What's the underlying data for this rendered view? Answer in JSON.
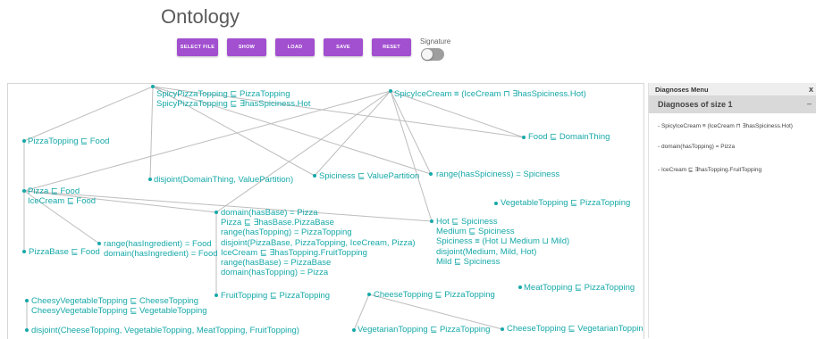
{
  "header": {
    "title": "Ontology",
    "buttons": [
      "SELECT FILE",
      "SHOW",
      "LOAD",
      "SAVE",
      "RESET"
    ],
    "signature_label": "Signature",
    "signature_on": false,
    "accent_color": "#a24fd0"
  },
  "graph": {
    "node_color": "#17a8a8",
    "edge_color": "#bdbdbd",
    "nodes": [
      {
        "id": "spicy-pizza-topping",
        "lines": [
          "SpicyPizzaTopping ⊑ PizzaTopping",
          "SpicyPizzaTopping ⊑ ∃hasSpiciness.Hot"
        ]
      },
      {
        "id": "spicy-ice-cream",
        "lines": [
          "SpicyIceCream ≡ (IceCream ⊓ ∃hasSpiciness.Hot)"
        ]
      },
      {
        "id": "pizza-topping-food",
        "lines": [
          "PizzaTopping ⊑ Food"
        ]
      },
      {
        "id": "food-domain-thing",
        "lines": [
          "Food ⊑ DomainThing"
        ]
      },
      {
        "id": "disjoint-domain-value",
        "lines": [
          "disjoint(DomainThing, ValuePartition)"
        ]
      },
      {
        "id": "spiciness-value-partition",
        "lines": [
          "Spiciness ⊑ ValuePartition"
        ]
      },
      {
        "id": "range-has-spiciness",
        "lines": [
          "range(hasSpiciness) = Spiciness"
        ]
      },
      {
        "id": "pizza-food",
        "lines": [
          "Pizza ⊑ Food",
          "IceCream ⊑ Food"
        ]
      },
      {
        "id": "vegetable-topping",
        "lines": [
          "VegetableTopping ⊑ PizzaTopping"
        ]
      },
      {
        "id": "domain-has-base",
        "lines": [
          "domain(hasBase) = Pizza",
          "Pizza ⊑ ∃hasBase.PizzaBase",
          "range(hasTopping) = PizzaTopping",
          "disjoint(PizzaBase, PizzaTopping, IceCream, Pizza)",
          "IceCream ⊑ ∃hasTopping.FruitTopping",
          "range(hasBase) = PizzaBase",
          "domain(hasTopping) = Pizza"
        ]
      },
      {
        "id": "hot-spiciness",
        "lines": [
          "Hot ⊑ Spiciness",
          "Medium ⊑ Spiciness",
          "Spiciness ≡ (Hot ⊔ Medium ⊔ Mild)",
          "disjoint(Medium, Mild, Hot)",
          "Mild ⊑ Spiciness"
        ]
      },
      {
        "id": "range-has-ingredient",
        "lines": [
          "range(hasIngredient) = Food",
          "domain(hasIngredient) = Food"
        ]
      },
      {
        "id": "pizza-base-food",
        "lines": [
          "PizzaBase ⊑ Food"
        ]
      },
      {
        "id": "fruit-topping",
        "lines": [
          "FruitTopping ⊑ PizzaTopping"
        ]
      },
      {
        "id": "cheese-topping",
        "lines": [
          "CheeseTopping ⊑ PizzaTopping"
        ]
      },
      {
        "id": "meat-topping",
        "lines": [
          "MeatTopping ⊑ PizzaTopping"
        ]
      },
      {
        "id": "cheesy-vegetable",
        "lines": [
          "CheesyVegetableTopping ⊑ CheeseTopping",
          "CheesyVegetableTopping ⊑ VegetableTopping"
        ]
      },
      {
        "id": "disjoint-toppings",
        "lines": [
          "disjoint(CheeseTopping, VegetableTopping, MeatTopping, FruitTopping)"
        ]
      },
      {
        "id": "vegetarian-topping",
        "lines": [
          "VegetarianTopping ⊑ PizzaTopping"
        ]
      },
      {
        "id": "cheese-vegetarian",
        "lines": [
          "CheeseTopping ⊑ VegetarianTopping"
        ]
      }
    ],
    "edges": [
      [
        "spicy-pizza-topping",
        "pizza-topping-food"
      ],
      [
        "spicy-pizza-topping",
        "disjoint-domain-value"
      ],
      [
        "spicy-pizza-topping",
        "spiciness-value-partition"
      ],
      [
        "spicy-pizza-topping",
        "range-has-spiciness"
      ],
      [
        "spicy-pizza-topping",
        "food-domain-thing"
      ],
      [
        "spicy-ice-cream",
        "food-domain-thing"
      ],
      [
        "spicy-ice-cream",
        "spiciness-value-partition"
      ],
      [
        "spicy-ice-cream",
        "range-has-spiciness"
      ],
      [
        "spicy-ice-cream",
        "pizza-food"
      ],
      [
        "spicy-ice-cream",
        "domain-has-base"
      ],
      [
        "spicy-ice-cream",
        "hot-spiciness"
      ],
      [
        "pizza-food",
        "pizza-topping-food"
      ],
      [
        "pizza-food",
        "pizza-base-food"
      ],
      [
        "pizza-food",
        "range-has-ingredient"
      ],
      [
        "pizza-food",
        "domain-has-base"
      ],
      [
        "pizza-food",
        "hot-spiciness"
      ],
      [
        "domain-has-base",
        "fruit-topping"
      ],
      [
        "cheese-topping",
        "vegetarian-topping"
      ],
      [
        "cheese-topping",
        "cheese-vegetarian"
      ],
      [
        "cheesy-vegetable",
        "disjoint-toppings"
      ]
    ]
  },
  "diagnoses": {
    "menu_title": "Diagnoses Menu",
    "close_label": "X",
    "group_title": "Diagnoses of size 1",
    "collapse_label": "–",
    "items": [
      "- SpicyIceCream ≡ (IceCream ⊓ ∃hasSpiciness.Hot)",
      "- domain(hasTopping) = Pizza",
      "- IceCream ⊑ ∃hasTopping.FruitTopping"
    ]
  }
}
